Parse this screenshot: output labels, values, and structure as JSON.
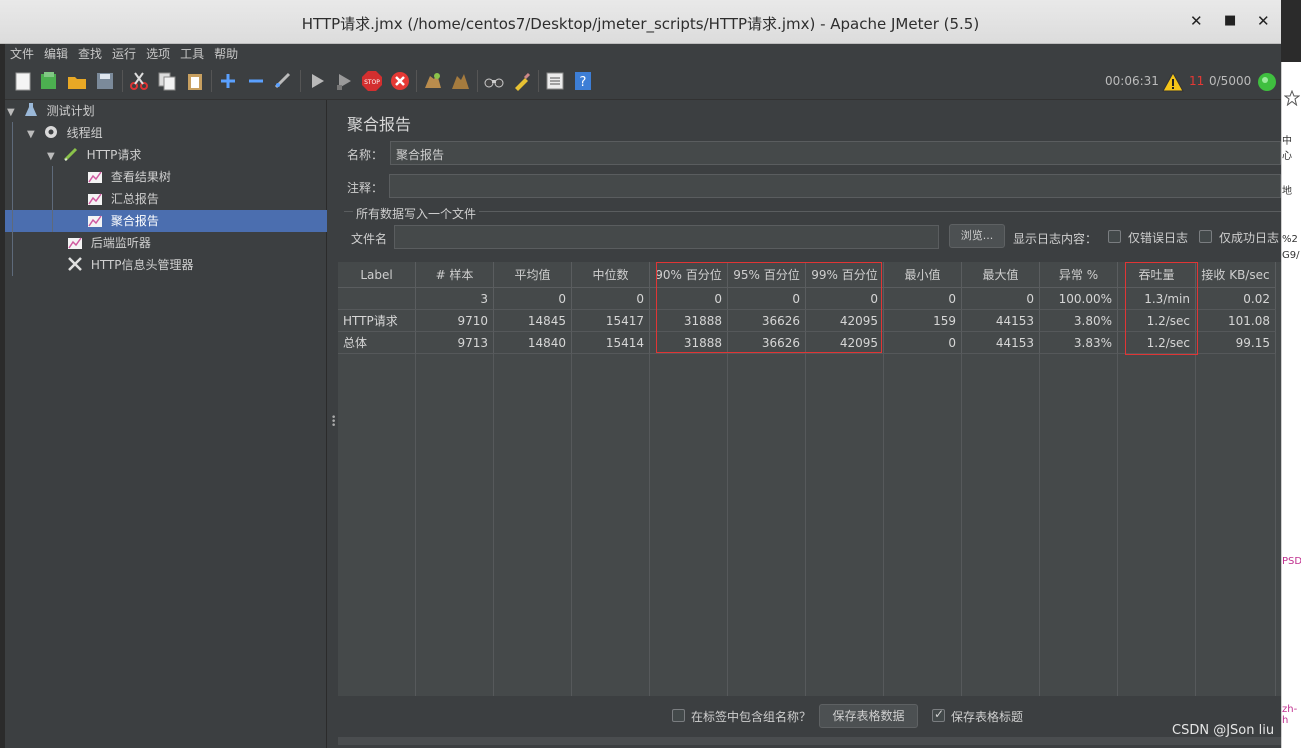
{
  "window": {
    "title": "HTTP请求.jmx (/home/centos7/Desktop/jmeter_scripts/HTTP请求.jmx) - Apache JMeter (5.5)",
    "controls": {
      "minimize": "✕",
      "restore": "▪",
      "close": "✕"
    }
  },
  "menu": [
    "文件",
    "编辑",
    "查找",
    "运行",
    "选项",
    "工具",
    "帮助"
  ],
  "toolbar": {
    "elapsed": "00:06:31",
    "warning_count": "11",
    "threads": "0/5000"
  },
  "tree": {
    "items": [
      {
        "label": "测试计划"
      },
      {
        "label": "线程组"
      },
      {
        "label": "HTTP请求"
      },
      {
        "label": "查看结果树"
      },
      {
        "label": "汇总报告"
      },
      {
        "label": "聚合报告"
      },
      {
        "label": "后端监听器"
      },
      {
        "label": "HTTP信息头管理器"
      }
    ]
  },
  "report": {
    "heading": "聚合报告",
    "name_label": "名称：",
    "name_value": "聚合报告",
    "comment_label": "注释：",
    "comment_value": "",
    "file_group_title": "所有数据写入一个文件",
    "filename_label": "文件名",
    "filename_value": "",
    "browse_label": "浏览...",
    "log_label": "显示日志内容：",
    "errors_only_label": "仅错误日志",
    "success_only_label": "仅成功日志"
  },
  "table": {
    "columns": [
      "Label",
      "# 样本",
      "平均值",
      "中位数",
      "90% 百分位",
      "95% 百分位",
      "99% 百分位",
      "最小值",
      "最大值",
      "异常 %",
      "吞吐量",
      "接收 KB/sec"
    ],
    "rows": [
      [
        "",
        "3",
        "0",
        "0",
        "0",
        "0",
        "0",
        "0",
        "0",
        "100.00%",
        "1.3/min",
        "0.02"
      ],
      [
        "HTTP请求",
        "9710",
        "14845",
        "15417",
        "31888",
        "36626",
        "42095",
        "159",
        "44153",
        "3.80%",
        "1.2/sec",
        "101.08"
      ],
      [
        "总体",
        "9713",
        "14840",
        "15414",
        "31888",
        "36626",
        "42095",
        "0",
        "44153",
        "3.83%",
        "1.2/sec",
        "99.15"
      ]
    ]
  },
  "bottom": {
    "include_group_label": "在标签中包含组名称？",
    "save_table_label": "保存表格数据",
    "save_header_label": "保存表格标题"
  },
  "watermark": "CSDN @JSon  liu",
  "outside": {
    "right_texts": [
      "中心",
      "地",
      "%2",
      "G9/",
      "PSD",
      "zh-h"
    ]
  }
}
